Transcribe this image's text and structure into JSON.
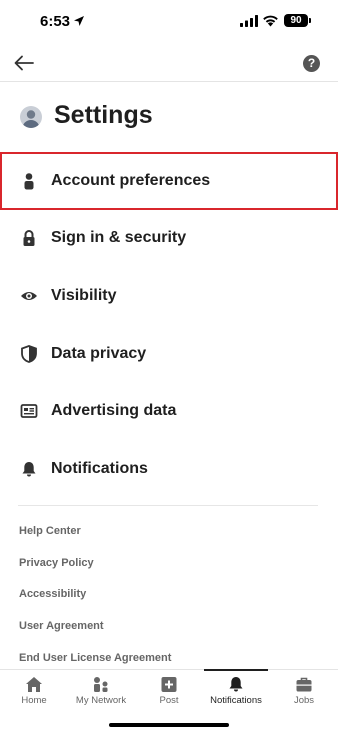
{
  "status_bar": {
    "time": "6:53",
    "battery": "90",
    "location_icon": "location-arrow-icon",
    "signal_icon": "cellular-signal-icon",
    "wifi_icon": "wifi-icon"
  },
  "top_nav": {
    "back_icon": "arrow-left-icon",
    "help_icon": "question-mark-icon",
    "help_glyph": "?"
  },
  "header": {
    "title": "Settings",
    "avatar_icon": "user-avatar"
  },
  "menu": {
    "items": [
      {
        "label": "Account preferences",
        "icon": "person-icon",
        "selected": true
      },
      {
        "label": "Sign in & security",
        "icon": "lock-icon"
      },
      {
        "label": "Visibility",
        "icon": "eye-icon"
      },
      {
        "label": "Data privacy",
        "icon": "shield-icon"
      },
      {
        "label": "Advertising data",
        "icon": "ad-card-icon"
      },
      {
        "label": "Notifications",
        "icon": "bell-icon"
      }
    ]
  },
  "links": [
    "Help Center",
    "Privacy Policy",
    "Accessibility",
    "User Agreement",
    "End User License Agreement"
  ],
  "tab_bar": {
    "tabs": [
      {
        "label": "Home",
        "icon": "home-icon"
      },
      {
        "label": "My Network",
        "icon": "network-icon"
      },
      {
        "label": "Post",
        "icon": "plus-square-icon"
      },
      {
        "label": "Notifications",
        "icon": "bell-icon",
        "active": true
      },
      {
        "label": "Jobs",
        "icon": "briefcase-icon"
      }
    ]
  },
  "colors": {
    "selection_outline": "#d9262c",
    "text_primary": "#1f1f1f",
    "text_secondary": "#666666"
  }
}
